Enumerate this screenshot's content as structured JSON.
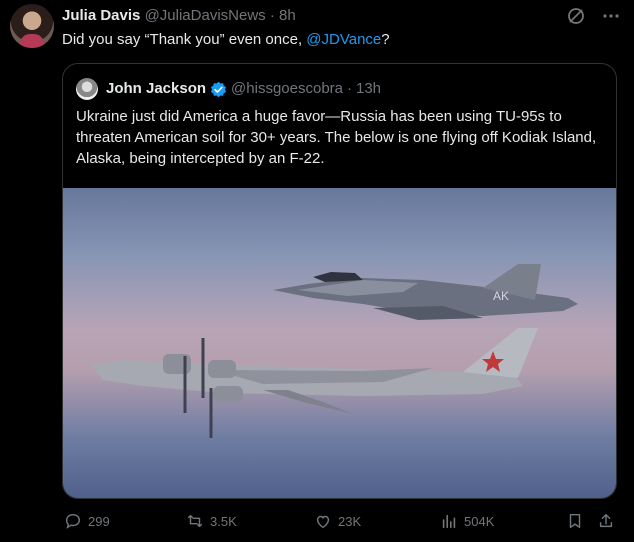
{
  "tweet": {
    "author_name": "Julia Davis",
    "author_handle": "@JuliaDavisNews",
    "separator": "·",
    "time": "8h",
    "text_before": "Did you say “Thank you” even once, ",
    "mention": "@JDVance",
    "text_after": "?",
    "more_icon": "more-horizontal-icon",
    "grok_icon": "grok-icon"
  },
  "quote": {
    "author_name": "John Jackson",
    "author_handle": "@hissgoescobra",
    "separator": "·",
    "time": "13h",
    "text": "Ukraine just did America a huge favor—Russia has been using TU-95s to threaten American soil for 30+ years. The below is one flying off Kodiak Island, Alaska, being intercepted by an F-22.",
    "verified_icon": "verified-badge-icon",
    "image_marking": "AK"
  },
  "actions": {
    "replies": "299",
    "reposts": "3.5K",
    "likes": "23K",
    "views": "504K"
  },
  "colors": {
    "background": "#000000",
    "text": "#e7e9ea",
    "muted": "#71767b",
    "accent": "#1d9bf0",
    "border": "#2f3336"
  }
}
